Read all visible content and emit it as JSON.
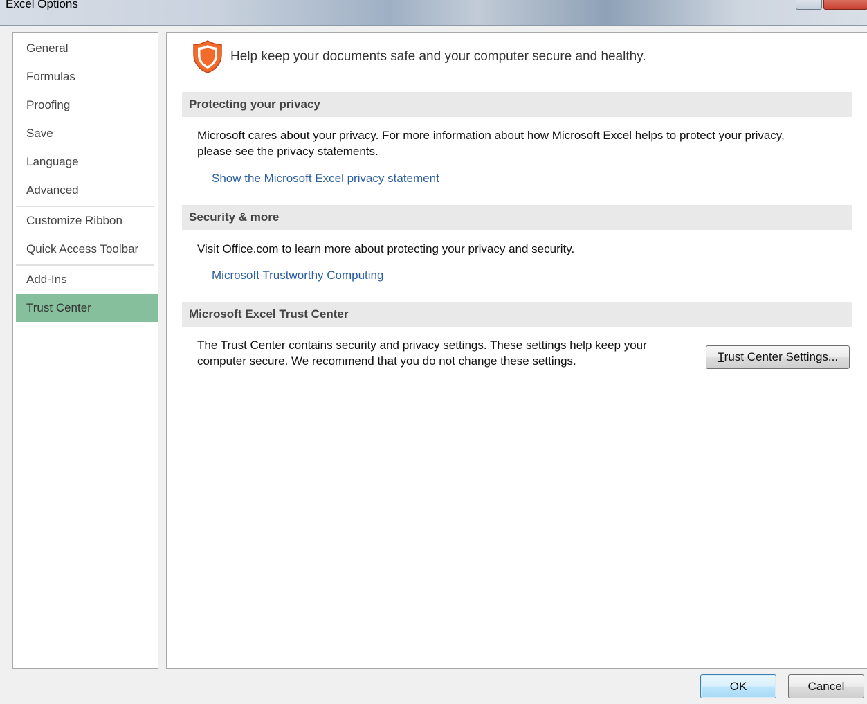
{
  "window": {
    "title": "Excel Options"
  },
  "nav": {
    "items": [
      {
        "label": "General"
      },
      {
        "label": "Formulas"
      },
      {
        "label": "Proofing"
      },
      {
        "label": "Save"
      },
      {
        "label": "Language"
      },
      {
        "label": "Advanced"
      },
      {
        "label": "Customize Ribbon"
      },
      {
        "label": "Quick Access Toolbar"
      },
      {
        "label": "Add-Ins"
      },
      {
        "label": "Trust Center"
      }
    ],
    "selected": "Trust Center"
  },
  "content": {
    "icon": "shield-icon",
    "headline": "Help keep your documents safe and your computer secure and healthy.",
    "sections": [
      {
        "header": "Protecting your privacy",
        "text_line1": "Microsoft cares about your privacy. For more information about how Microsoft Excel helps to protect your privacy,",
        "text_line2": "please see the privacy statements.",
        "link": "Show the Microsoft Excel privacy statement"
      },
      {
        "header": "Security & more",
        "text_line1": "Visit Office.com to learn more about protecting your privacy and security.",
        "link": "Microsoft Trustworthy Computing"
      },
      {
        "header": "Microsoft Excel Trust Center",
        "text_line1": "The Trust Center contains security and privacy settings. These settings help keep your",
        "text_line2": "computer secure. We recommend that you do not change these settings.",
        "button_accel": "T",
        "button_rest": "rust Center Settings..."
      }
    ]
  },
  "footer": {
    "ok_label": "OK",
    "cancel_label": "Cancel"
  },
  "colors": {
    "nav_selected": "#86bf9b",
    "section_header_bg": "#e9e9e9",
    "link": "#2a5d9e",
    "shield": "#f26b2b"
  }
}
